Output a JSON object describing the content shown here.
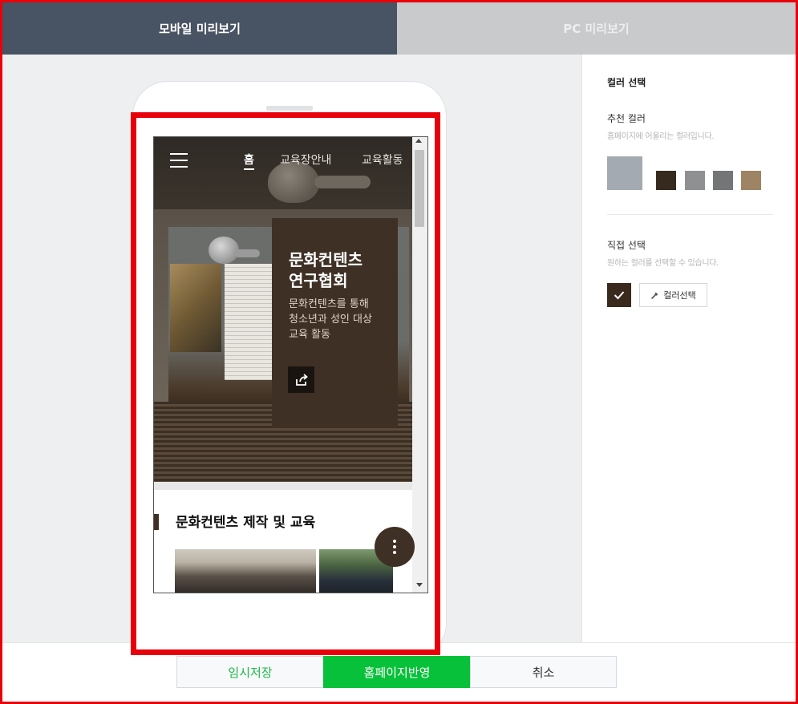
{
  "tabs": {
    "mobile_label": "모바일 미리보기",
    "pc_label": "PC 미리보기"
  },
  "site": {
    "nav_items": [
      "홈",
      "교육장안내",
      "교육활동"
    ],
    "hero_title_line1": "문화컨텐츠",
    "hero_title_line2": "연구협회",
    "hero_desc_line1": "문화컨텐츠를 통해",
    "hero_desc_line2": "청소년과 성인 대상",
    "hero_desc_line3": "교육 활동",
    "section_title": "문화컨텐츠 제작 및 교육"
  },
  "color_panel": {
    "title": "컬러 선택",
    "recommended_label": "추천 컬러",
    "recommended_desc": "홈페이지에 어울리는 컬러입니다.",
    "swatches": [
      "#a3aab1",
      "#362a1f",
      "#8f9091",
      "#737577",
      "#9e8464"
    ],
    "direct_label": "직접 선택",
    "direct_desc": "원하는 컬러를 선택할 수 있습니다.",
    "selected_color": "#3a2a1e",
    "picker_label": "컬러선택"
  },
  "footer": {
    "temp_save_label": "임시저장",
    "apply_label": "홈페이지반영",
    "cancel_label": "취소"
  },
  "colors": {
    "tab_active": "#485363",
    "accent_green": "#06c139",
    "highlight_red": "#e8000a",
    "theme_brown": "#3f3025"
  }
}
